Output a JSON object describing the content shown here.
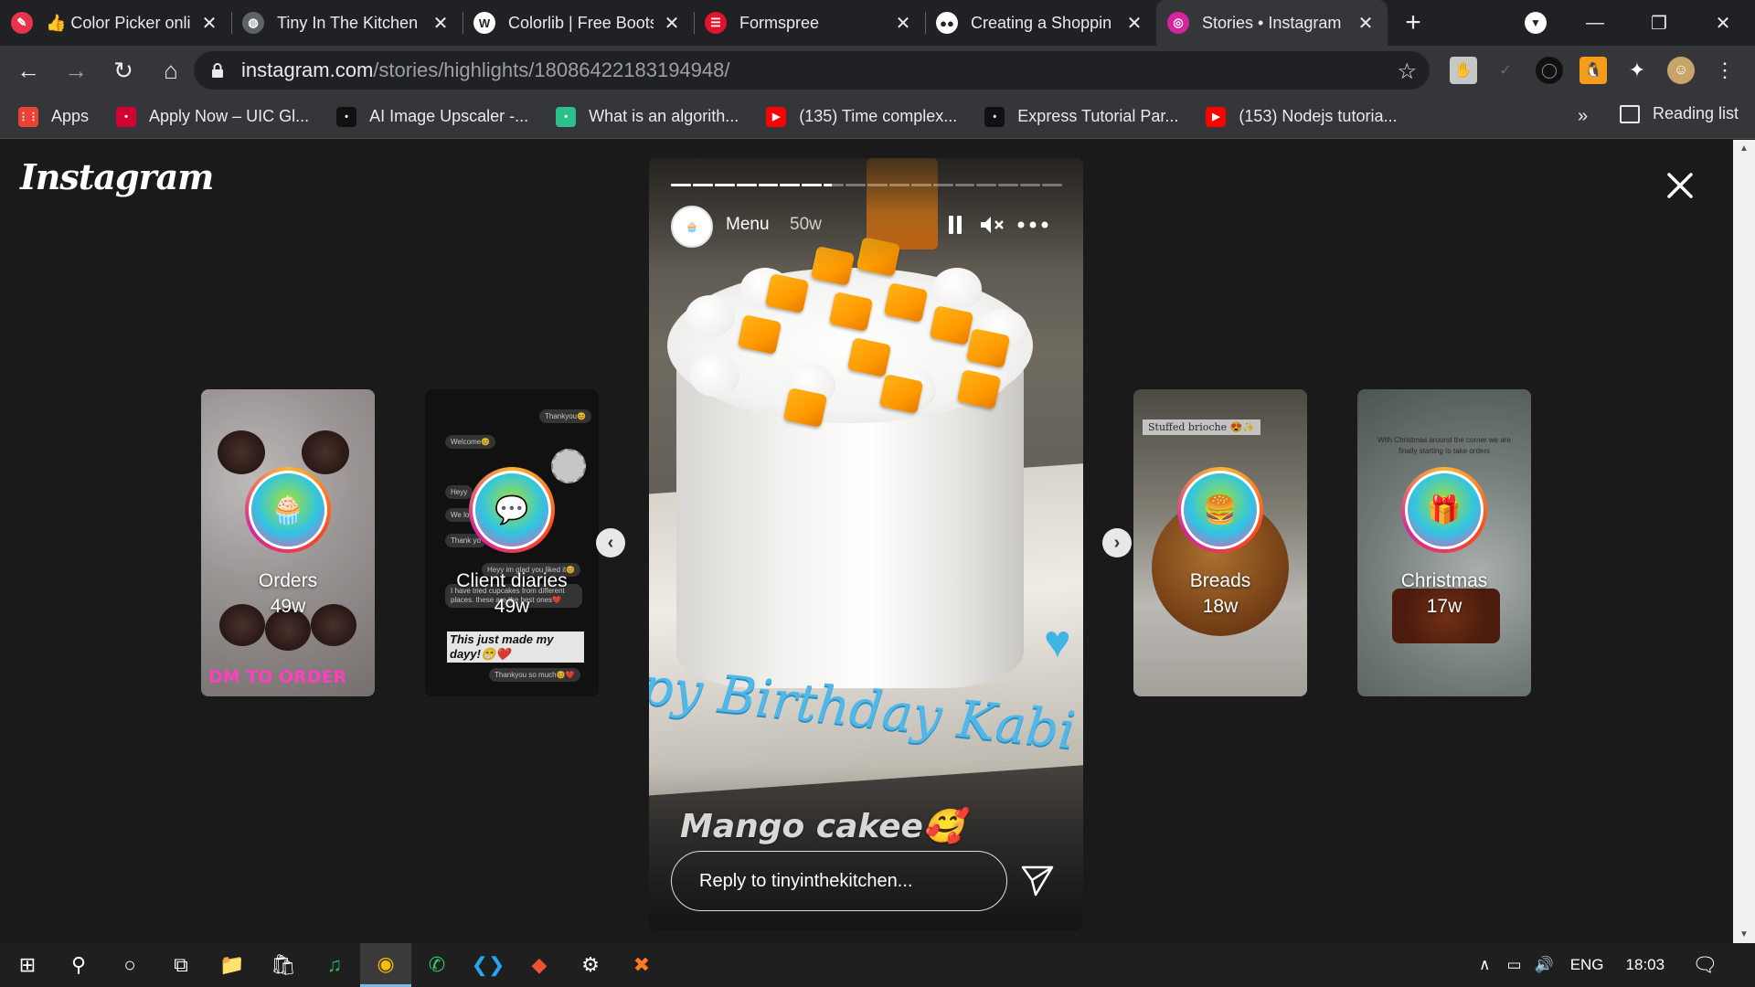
{
  "browser": {
    "tabs": [
      {
        "title": "👍 Color Picker onli",
        "favicon": "color-picker-icon",
        "color": "#e8344a",
        "glyph": "✎"
      },
      {
        "title": "Tiny In The Kitchen",
        "favicon": "globe-icon",
        "color": "#5f6368",
        "glyph": "◍"
      },
      {
        "title": "Colorlib | Free Boots",
        "favicon": "wordpress-icon",
        "color": "#ffffff",
        "glyph": "W"
      },
      {
        "title": "Formspree",
        "favicon": "formspree-icon",
        "color": "#e5122e",
        "glyph": "☰"
      },
      {
        "title": "Creating a Shoppin",
        "favicon": "medium-icon",
        "color": "#ffffff",
        "glyph": "●●"
      },
      {
        "title": "Stories • Instagram",
        "favicon": "instagram-icon",
        "color": "#d6249f",
        "glyph": "◎"
      }
    ],
    "active_tab": 5,
    "url_domain": "instagram.com",
    "url_path": "/stories/highlights/18086422183194948/",
    "bookmarks": [
      {
        "label": "Apps",
        "icon": "apps-grid-icon",
        "color": "#ea4335"
      },
      {
        "label": "Apply Now – UIC Gl...",
        "icon": "uic-icon",
        "color": "#d50032"
      },
      {
        "label": "AI Image Upscaler -...",
        "icon": "upscaler-icon",
        "color": "#111111"
      },
      {
        "label": "What is an algorith...",
        "icon": "algorithm-icon",
        "color": "#2bbf8a"
      },
      {
        "label": "(135) Time complex...",
        "icon": "youtube-icon",
        "color": "#ff0000"
      },
      {
        "label": "Express Tutorial Par...",
        "icon": "express-icon",
        "color": "#111111"
      },
      {
        "label": "(153) Nodejs tutoria...",
        "icon": "youtube-icon",
        "color": "#ff0000"
      }
    ],
    "more_bookmarks": "»",
    "reading_list": "Reading list"
  },
  "instagram": {
    "logo": "Instagram",
    "highlights_left": [
      {
        "name": "Orders",
        "age": "49w",
        "icon": "cupcake-icon",
        "bg": "#5e4a42"
      },
      {
        "name": "Client diaries",
        "age": "49w",
        "icon": "chat-icon",
        "bg": "#151515"
      }
    ],
    "highlights_right": [
      {
        "name": "Breads",
        "age": "18w",
        "icon": "bread-icon",
        "bg": "#6f6b5c",
        "label": "Stuffed brioche 😍✨"
      },
      {
        "name": "Christmas",
        "age": "17w",
        "icon": "gift-icon",
        "bg": "#8a9490",
        "label": "With Christmas around the corner we are finally starting to take orders"
      }
    ],
    "orders_overlay": "DM TO ORDER",
    "client_chat": {
      "msgs": [
        "Thankyou😊",
        "Welcome😊",
        "Heyy",
        "We lo",
        "Thank yo",
        "Heyy im glad you liked it😊",
        "I have tried cupcakes from different places. these are the best ones❤️",
        "Thankyou so much😊❤️"
      ],
      "highlight": "This just made my dayy!😁❤️"
    },
    "story": {
      "user": "Menu",
      "time": "50w",
      "caption": "Mango cakee🥰",
      "reply_placeholder": "Reply to tinyinthekitchen...",
      "progress": {
        "segments": 18,
        "completed": 7,
        "current_fill": 0.4
      },
      "cake_text": "py Birthday Kabi"
    }
  },
  "taskbar": {
    "apps": [
      {
        "icon": "windows-start-icon"
      },
      {
        "icon": "search-icon"
      },
      {
        "icon": "cortana-icon"
      },
      {
        "icon": "task-view-icon"
      },
      {
        "icon": "file-explorer-icon"
      },
      {
        "icon": "store-icon"
      },
      {
        "icon": "spotify-icon"
      },
      {
        "icon": "chrome-icon"
      },
      {
        "icon": "whatsapp-icon"
      },
      {
        "icon": "vscode-icon"
      },
      {
        "icon": "git-icon"
      },
      {
        "icon": "settings-icon"
      },
      {
        "icon": "xampp-icon"
      }
    ],
    "lang": "ENG",
    "time": "18:03"
  }
}
